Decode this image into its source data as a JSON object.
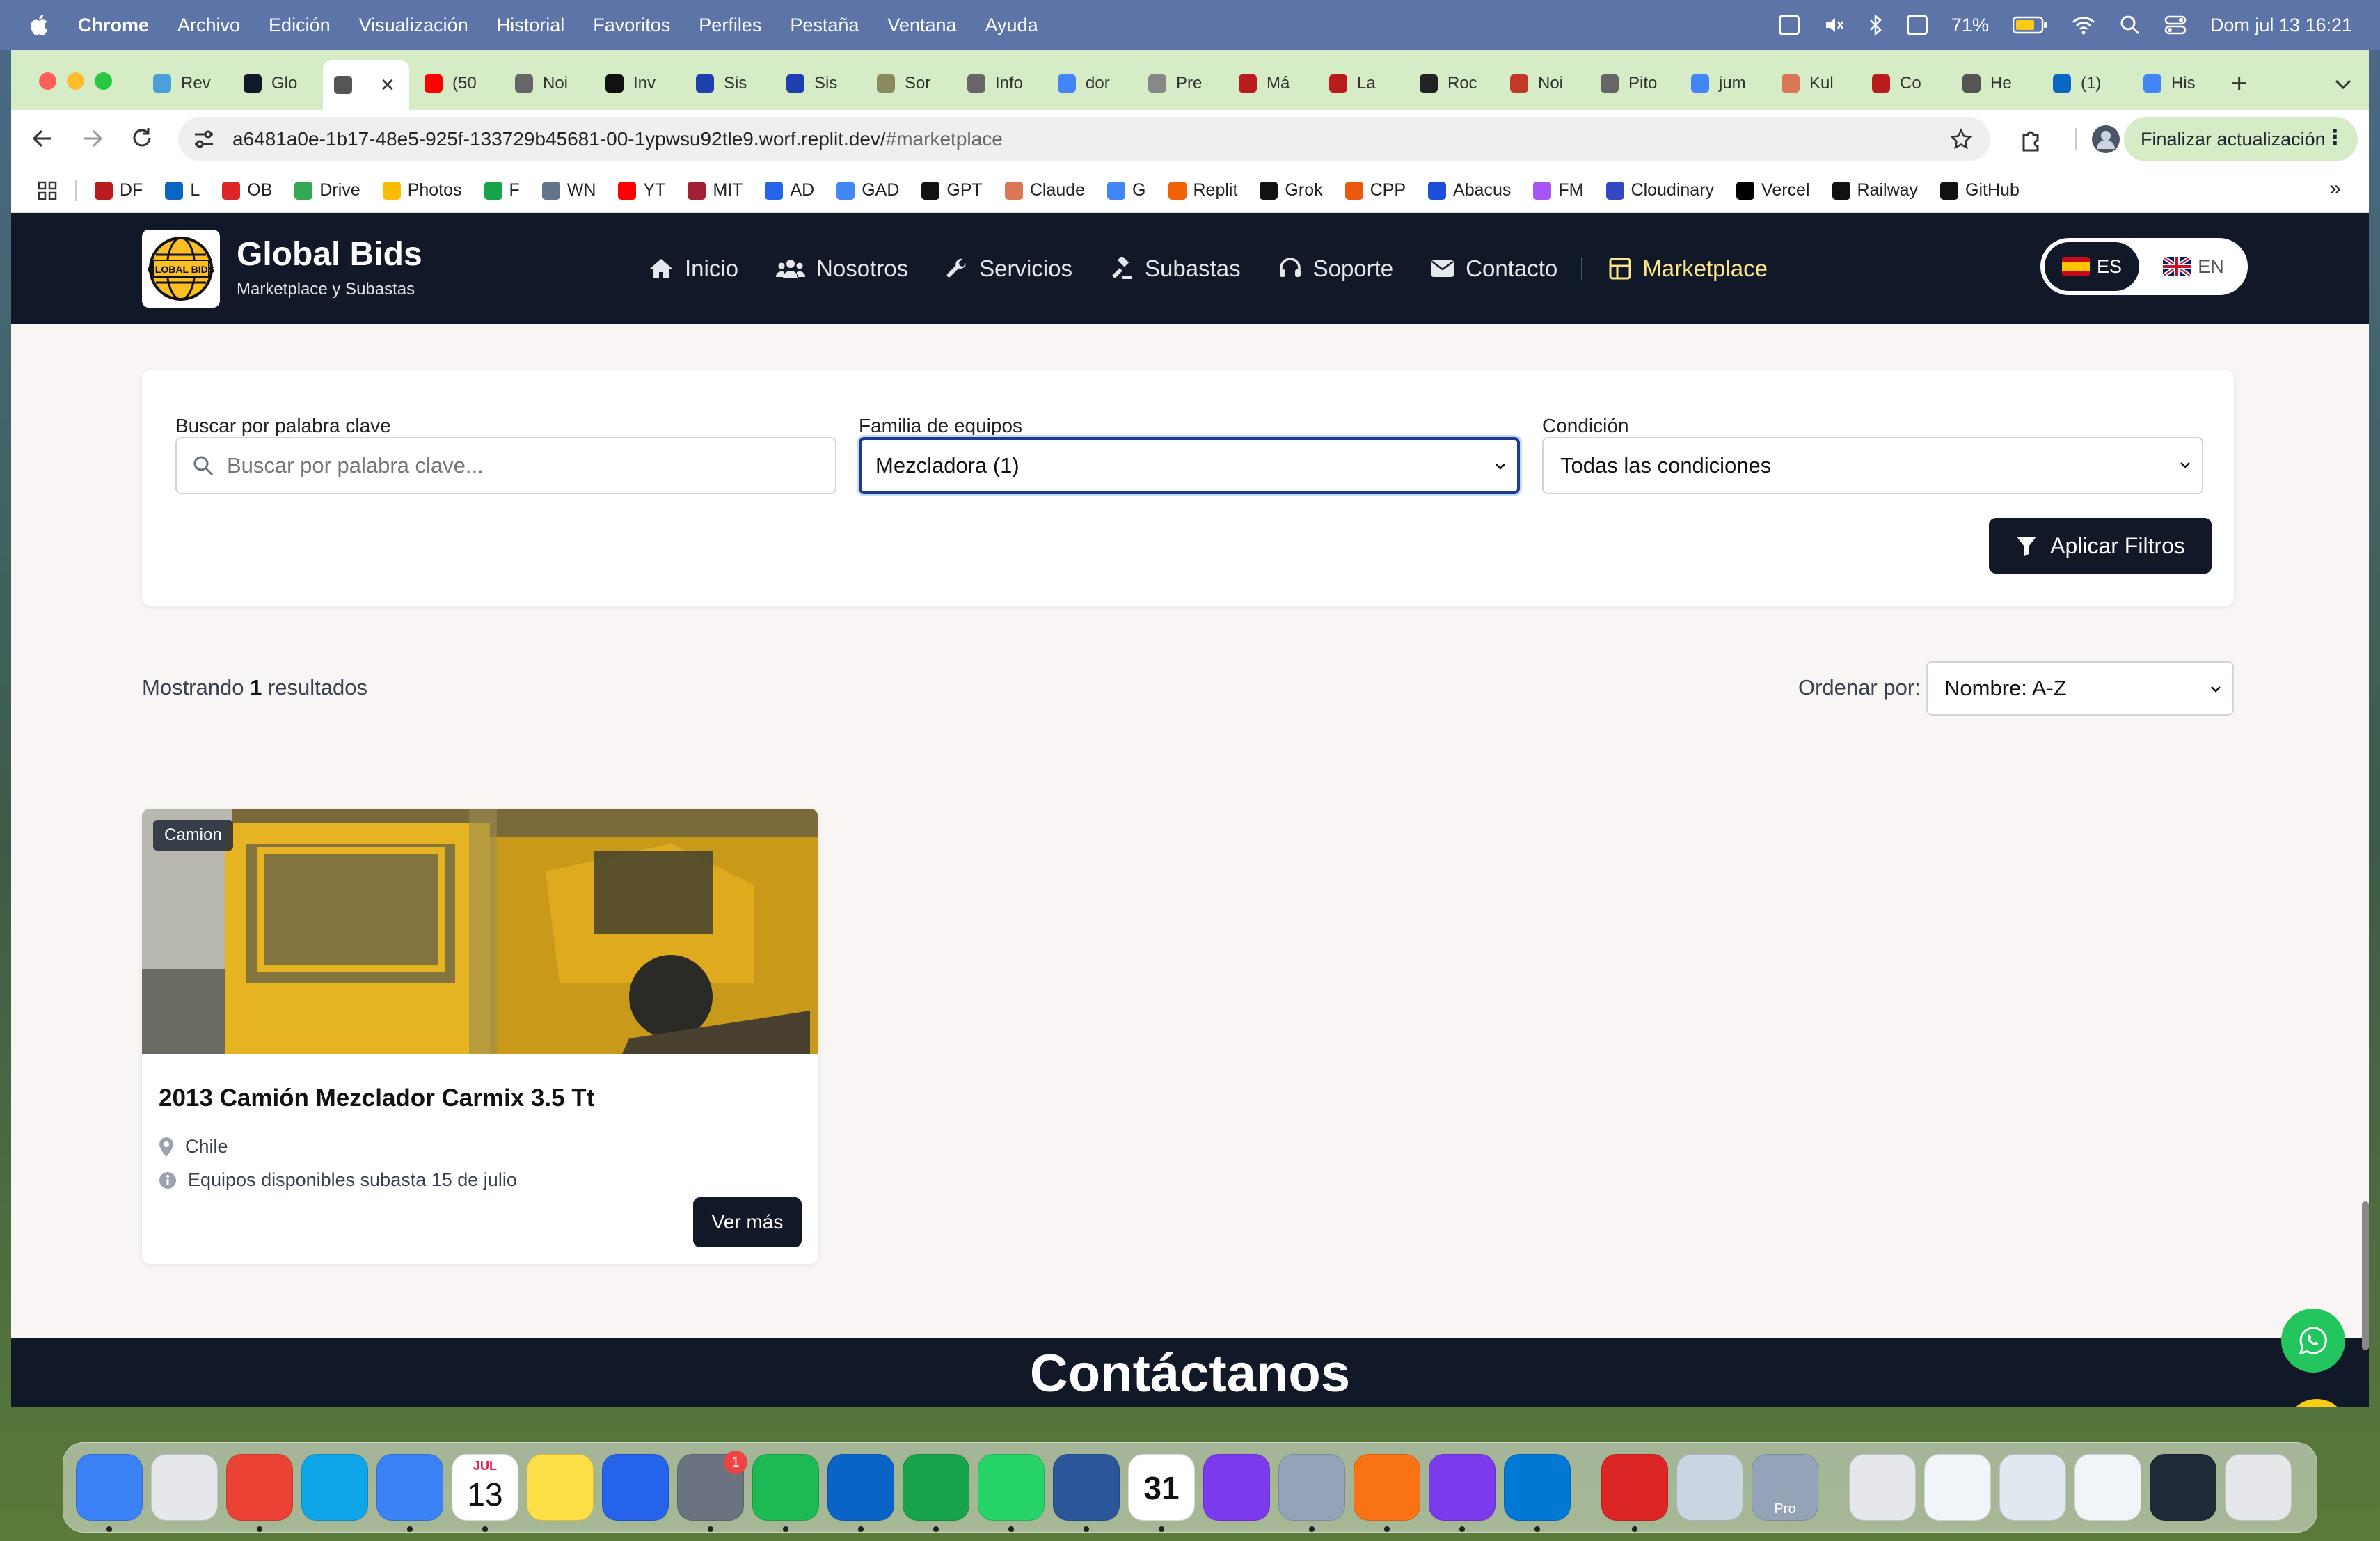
{
  "menubar": {
    "app_name": "Chrome",
    "items": [
      "Archivo",
      "Edición",
      "Visualización",
      "Historial",
      "Favoritos",
      "Perfiles",
      "Pestaña",
      "Ventana",
      "Ayuda"
    ],
    "battery": "71%",
    "datetime": "Dom jul 13  16:21"
  },
  "tabs": [
    {
      "label": "Rev",
      "color": "#4a9eda"
    },
    {
      "label": "Glo",
      "color": "#111827"
    },
    {
      "label": "",
      "color": "#555",
      "active": true
    },
    {
      "label": "(50",
      "color": "#ff0000"
    },
    {
      "label": "Noi",
      "color": "#666"
    },
    {
      "label": "Inv",
      "color": "#111"
    },
    {
      "label": "Sis",
      "color": "#1e40af"
    },
    {
      "label": "Sis",
      "color": "#1e40af"
    },
    {
      "label": "Sor",
      "color": "#8a8a5a"
    },
    {
      "label": "Info",
      "color": "#666"
    },
    {
      "label": "dor",
      "color": "#4285f4"
    },
    {
      "label": "Pre",
      "color": "#888"
    },
    {
      "label": "Má",
      "color": "#b91c1c"
    },
    {
      "label": "La",
      "color": "#b91c1c"
    },
    {
      "label": "Roc",
      "color": "#222"
    },
    {
      "label": "Noi",
      "color": "#c0392b"
    },
    {
      "label": "Pito",
      "color": "#666"
    },
    {
      "label": "jum",
      "color": "#4285f4"
    },
    {
      "label": "Kul",
      "color": "#d97757"
    },
    {
      "label": "Co",
      "color": "#b91c1c"
    },
    {
      "label": "He",
      "color": "#555"
    },
    {
      "label": "(1)",
      "color": "#0a66c2"
    },
    {
      "label": "His",
      "color": "#4285f4"
    }
  ],
  "omnibox": {
    "url_main": "a6481a0e-1b17-48e5-925f-133729b45681-00-1ypwsu92tle9.worf.replit.dev/",
    "url_hash": "#marketplace"
  },
  "update_button": "Finalizar actualización",
  "bookmarks": [
    {
      "label": "DF",
      "color": "#b91c1c"
    },
    {
      "label": "L",
      "color": "#0a66c2"
    },
    {
      "label": "OB",
      "color": "#dc2626"
    },
    {
      "label": "Drive",
      "color": "#34a853"
    },
    {
      "label": "Photos",
      "color": "#fbbc05"
    },
    {
      "label": "F",
      "color": "#16a34a"
    },
    {
      "label": "WN",
      "color": "#64748b"
    },
    {
      "label": "YT",
      "color": "#ff0000"
    },
    {
      "label": "MIT",
      "color": "#a31f34"
    },
    {
      "label": "AD",
      "color": "#2563eb"
    },
    {
      "label": "GAD",
      "color": "#4285f4"
    },
    {
      "label": "GPT",
      "color": "#111"
    },
    {
      "label": "Claude",
      "color": "#d97757"
    },
    {
      "label": "G",
      "color": "#4285f4"
    },
    {
      "label": "Replit",
      "color": "#f26207"
    },
    {
      "label": "Grok",
      "color": "#111"
    },
    {
      "label": "CPP",
      "color": "#ea580c"
    },
    {
      "label": "Abacus",
      "color": "#1d4ed8"
    },
    {
      "label": "FM",
      "color": "#a855f7"
    },
    {
      "label": "Cloudinary",
      "color": "#3448c5"
    },
    {
      "label": "Vercel",
      "color": "#000"
    },
    {
      "label": "Railway",
      "color": "#111"
    },
    {
      "label": "GitHub",
      "color": "#111"
    }
  ],
  "site": {
    "brand": "Global Bids",
    "tagline": "Marketplace y Subastas",
    "logo_text": "GLOBAL BIDS",
    "nav": [
      {
        "label": "Inicio",
        "icon": "home-icon"
      },
      {
        "label": "Nosotros",
        "icon": "users-icon"
      },
      {
        "label": "Servicios",
        "icon": "wrench-icon"
      },
      {
        "label": "Subastas",
        "icon": "gavel-icon"
      },
      {
        "label": "Soporte",
        "icon": "headset-icon"
      },
      {
        "label": "Contacto",
        "icon": "envelope-icon"
      },
      {
        "label": "Marketplace",
        "icon": "grid-icon",
        "active": true
      }
    ],
    "lang": {
      "es": "ES",
      "en": "EN"
    }
  },
  "filters": {
    "keyword_label": "Buscar por palabra clave",
    "keyword_placeholder": "Buscar por palabra clave...",
    "family_label": "Familia de equipos",
    "family_value": "Mezcladora (1)",
    "condition_label": "Condición",
    "condition_value": "Todas las condiciones",
    "apply_label": "Aplicar Filtros"
  },
  "results": {
    "prefix": "Mostrando",
    "count": "1",
    "suffix": "resultados",
    "sort_label": "Ordenar por:",
    "sort_value": "Nombre: A-Z"
  },
  "product": {
    "badge": "Camion",
    "title": "2013 Camión Mezclador Carmix 3.5 Tt",
    "location": "Chile",
    "info": "Equipos disponibles subasta 15 de julio",
    "button": "Ver más"
  },
  "contact_heading": "Contáctanos",
  "colors": {
    "header_bg": "#111827",
    "accent_active_nav": "#fde68a",
    "whatsapp": "#22c55e",
    "scroll_top": "#facc15"
  },
  "dock": [
    {
      "name": "finder",
      "color": "#3b82f6"
    },
    {
      "name": "launchpad",
      "color": "#e5e7eb"
    },
    {
      "name": "chrome",
      "color": "#ea4335"
    },
    {
      "name": "safari",
      "color": "#0ea5e9"
    },
    {
      "name": "mail",
      "color": "#3b82f6"
    },
    {
      "name": "calendar",
      "color": "#ffffff",
      "month": "JUL",
      "day": "13"
    },
    {
      "name": "notes",
      "color": "#fde047"
    },
    {
      "name": "keynote",
      "color": "#2563eb"
    },
    {
      "name": "settings",
      "color": "#6b7280",
      "badge": "1"
    },
    {
      "name": "spotify",
      "color": "#1db954"
    },
    {
      "name": "outlook",
      "color": "#0a64c8"
    },
    {
      "name": "excel",
      "color": "#16a34a"
    },
    {
      "name": "whatsapp",
      "color": "#25d366"
    },
    {
      "name": "word",
      "color": "#2b579a"
    },
    {
      "name": "calendar-31",
      "color": "#ffffff",
      "day": "31"
    },
    {
      "name": "screen-recorder",
      "color": "#7c3aed"
    },
    {
      "name": "iphone-mirroring",
      "color": "#94a3b8"
    },
    {
      "name": "setapp",
      "color": "#f97316"
    },
    {
      "name": "github-desktop",
      "color": "#7c3aed"
    },
    {
      "name": "vscode",
      "color": "#0078d4"
    },
    {
      "name": "acrobat",
      "color": "#dc2626"
    },
    {
      "name": "preview",
      "color": "#cbd5e1"
    },
    {
      "name": "pro",
      "color": "#94a3b8",
      "label": "Pro"
    },
    {
      "name": "files-stack",
      "color": "#e5e7eb"
    },
    {
      "name": "doc-1",
      "color": "#f1f5f9"
    },
    {
      "name": "doc-2",
      "color": "#e2e8f0"
    },
    {
      "name": "doc-3",
      "color": "#f1f5f9"
    },
    {
      "name": "terminal-doc",
      "color": "#1f2937"
    },
    {
      "name": "trash",
      "color": "#e5e7eb"
    }
  ]
}
